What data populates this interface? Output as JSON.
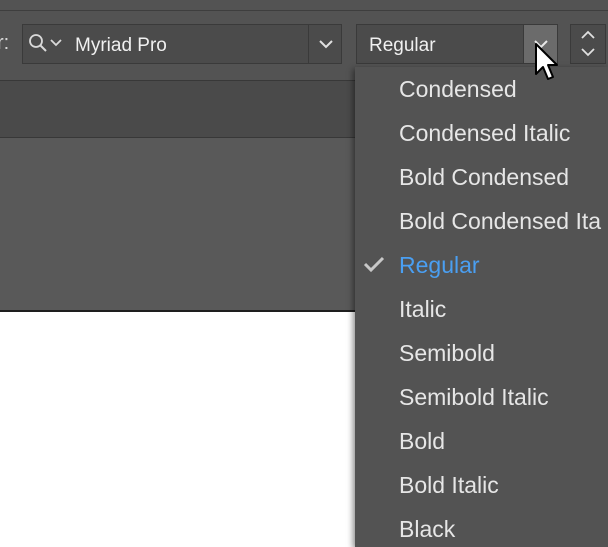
{
  "toolbar": {
    "cut_label": "r:",
    "font_family": {
      "value": "Myriad Pro",
      "search_icon": "search-icon",
      "dropdown_icon": "chevron-down-icon"
    },
    "font_style": {
      "value": "Regular",
      "dropdown_icon": "chevron-down-icon"
    },
    "stepper_icon": "up-down-stepper-icon"
  },
  "style_menu": {
    "items": [
      {
        "label": "Condensed",
        "selected": false
      },
      {
        "label": "Condensed Italic",
        "selected": false
      },
      {
        "label": "Bold Condensed",
        "selected": false
      },
      {
        "label": "Bold Condensed Ita",
        "selected": false
      },
      {
        "label": "Regular",
        "selected": true
      },
      {
        "label": "Italic",
        "selected": false
      },
      {
        "label": "Semibold",
        "selected": false
      },
      {
        "label": "Semibold Italic",
        "selected": false
      },
      {
        "label": "Bold",
        "selected": false
      },
      {
        "label": "Bold Italic",
        "selected": false
      },
      {
        "label": "Black",
        "selected": false
      }
    ],
    "check_icon": "checkmark-icon",
    "selected_color": "#4a9ff2"
  },
  "colors": {
    "bar_bg": "#535353",
    "menu_bg": "#535353",
    "text": "#e6e6e6",
    "accent": "#4a9ff2"
  }
}
